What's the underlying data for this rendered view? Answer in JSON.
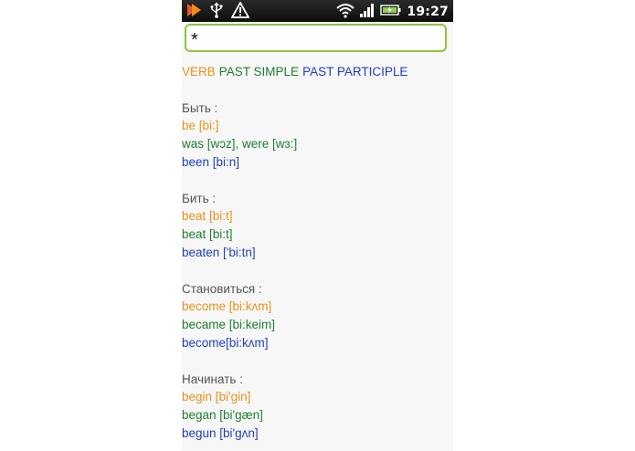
{
  "status_bar": {
    "time": "19:27",
    "icons": [
      "app-notification-icon",
      "usb-icon",
      "warning-icon",
      "wifi-icon",
      "signal-icon",
      "battery-icon"
    ]
  },
  "search": {
    "value": "*"
  },
  "legend": {
    "verb": "VERB",
    "past_simple": "PAST SIMPLE",
    "past_participle": "PAST PARTICIPLE"
  },
  "colors": {
    "verb": "#e8911a",
    "past_simple": "#1e7d32",
    "past_participle": "#1f3fbf",
    "heading": "#555555",
    "search_border": "#8dc63f"
  },
  "entries": [
    {
      "heading": "Быть :",
      "verb": "be [bi:]",
      "past_simple": "was [wɔz], were [wɜ:]",
      "past_participle": "been [bi:n]"
    },
    {
      "heading": "Бить :",
      "verb": "beat [bi:t]",
      "past_simple": "beat [bi:t]",
      "past_participle": "beaten ['bi:tn]"
    },
    {
      "heading": "Становиться :",
      "verb": "become [bi:kʌm]",
      "past_simple": "became [bi:keim]",
      "past_participle": "become[bi:kʌm]"
    },
    {
      "heading": "Начинать :",
      "verb": "begin [bi'gin]",
      "past_simple": "began [bi'gæn]",
      "past_participle": "begun [bi'gʌn]"
    }
  ]
}
